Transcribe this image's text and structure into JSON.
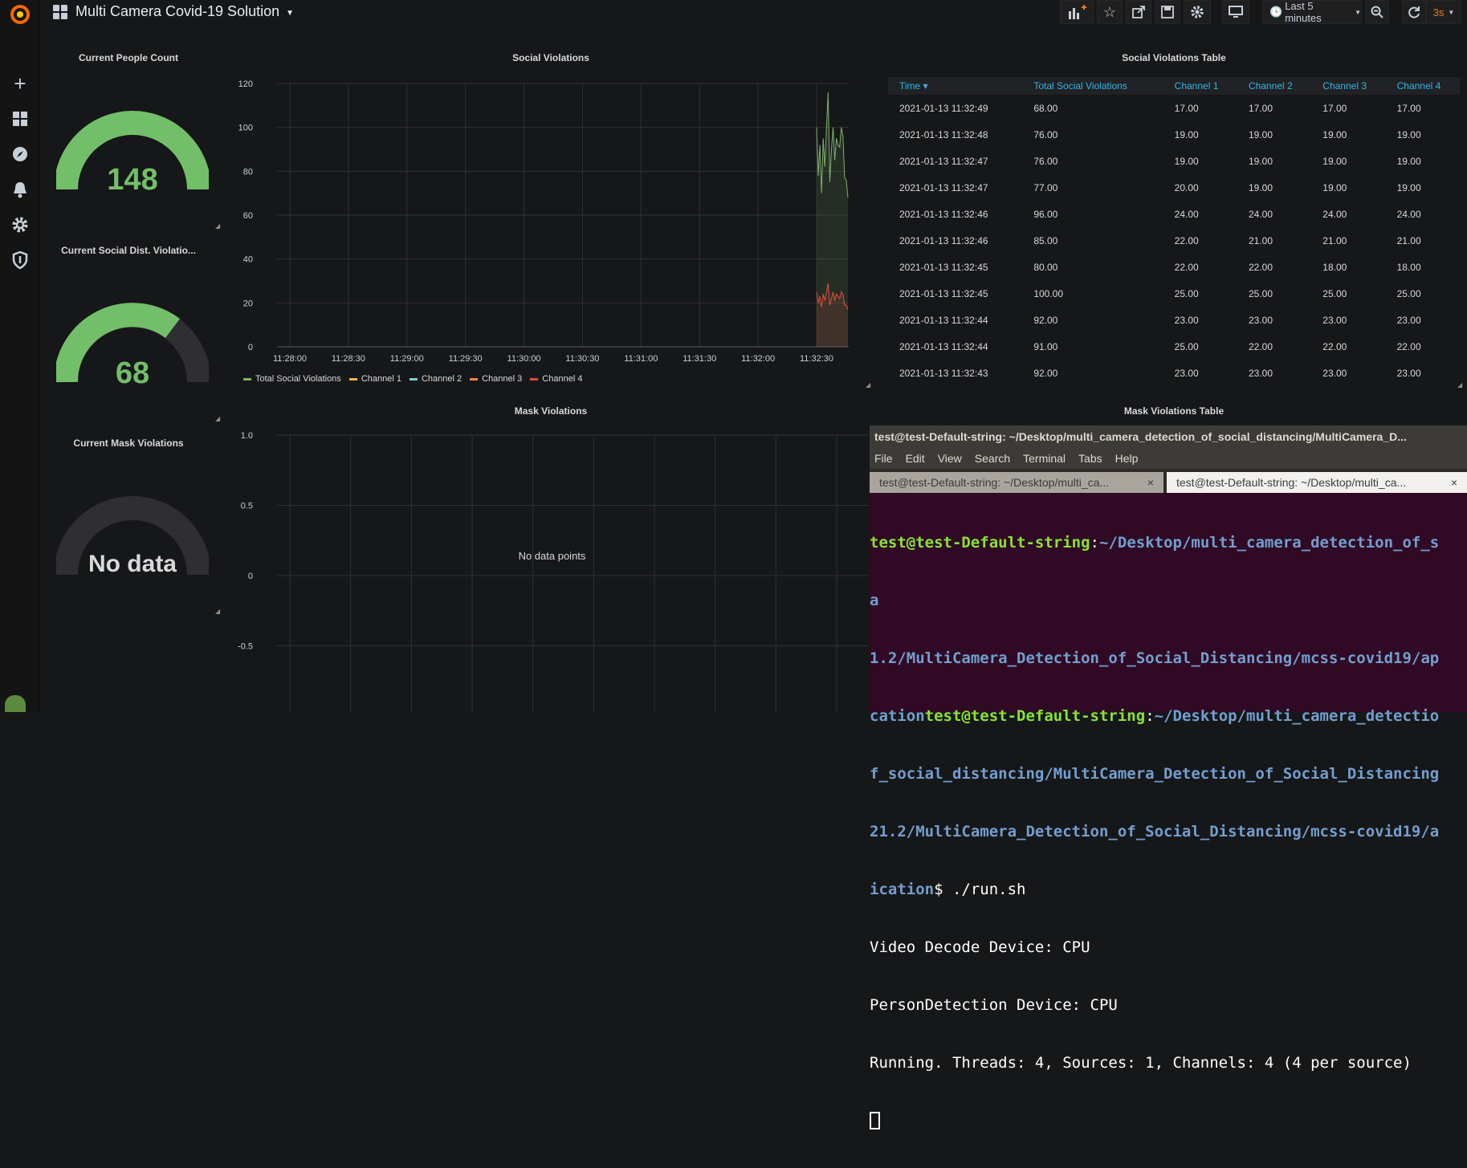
{
  "dashboard": {
    "title": "Multi Camera Covid-19 Solution",
    "time_range": "Last 5 minutes",
    "refresh": "3s"
  },
  "sidebar": {
    "icons": [
      "grafana-logo-icon",
      "plus-icon",
      "dashboards-icon",
      "explore-icon",
      "alerting-icon",
      "configuration-icon",
      "shield-icon",
      "user-avatar-icon"
    ]
  },
  "gauges": [
    {
      "title": "Current People Count",
      "value": "148",
      "fraction": 1.0,
      "color": "#73bf69"
    },
    {
      "title": "Current Social Dist. Violatio...",
      "value": "68",
      "fraction": 0.68,
      "color": "#73bf69"
    },
    {
      "title": "Current Mask Violations",
      "value": "No data",
      "fraction": 0,
      "color": "#d8d9da"
    }
  ],
  "social_chart": {
    "title": "Social Violations",
    "y_ticks": [
      "120",
      "100",
      "80",
      "60",
      "40",
      "20",
      "0"
    ],
    "x_ticks": [
      "11:28:00",
      "11:28:30",
      "11:29:00",
      "11:29:30",
      "11:30:00",
      "11:30:30",
      "11:31:00",
      "11:31:30",
      "11:32:00",
      "11:32:30"
    ],
    "legend": [
      {
        "name": "Total Social Violations",
        "color": "#7eb26d"
      },
      {
        "name": "Channel 1",
        "color": "#eab839"
      },
      {
        "name": "Channel 2",
        "color": "#6ed0e0"
      },
      {
        "name": "Channel 3",
        "color": "#ef843c"
      },
      {
        "name": "Channel 4",
        "color": "#e24d42"
      }
    ]
  },
  "chart_data": {
    "type": "line",
    "title": "Social Violations",
    "xlabel": "",
    "ylabel": "",
    "ylim": [
      0,
      120
    ],
    "x": [
      "11:32:30",
      "11:32:31",
      "11:32:32",
      "11:32:33",
      "11:32:34",
      "11:32:35",
      "11:32:36",
      "11:32:37",
      "11:32:38",
      "11:32:39",
      "11:32:40",
      "11:32:41",
      "11:32:42",
      "11:32:43",
      "11:32:44",
      "11:32:45",
      "11:32:46",
      "11:32:47",
      "11:32:48",
      "11:32:49"
    ],
    "series": [
      {
        "name": "Total Social Violations",
        "values": [
          100,
          78,
          92,
          70,
          95,
          82,
          100,
          116,
          75,
          90,
          100,
          85,
          95,
          92,
          91,
          100,
          96,
          77,
          76,
          68
        ]
      },
      {
        "name": "Channel 4",
        "values": [
          25,
          20,
          23,
          18,
          24,
          21,
          25,
          29,
          19,
          22,
          25,
          21,
          24,
          23,
          22,
          25,
          24,
          19,
          19,
          17
        ]
      }
    ],
    "grid": true,
    "legend": "bottom"
  },
  "social_table": {
    "title": "Social Violations Table",
    "columns": [
      "Time",
      "Total Social Violations",
      "Channel 1",
      "Channel 2",
      "Channel 3",
      "Channel 4"
    ],
    "rows": [
      [
        "2021-01-13 11:32:49",
        "68.00",
        "17.00",
        "17.00",
        "17.00",
        "17.00"
      ],
      [
        "2021-01-13 11:32:48",
        "76.00",
        "19.00",
        "19.00",
        "19.00",
        "19.00"
      ],
      [
        "2021-01-13 11:32:47",
        "76.00",
        "19.00",
        "19.00",
        "19.00",
        "19.00"
      ],
      [
        "2021-01-13 11:32:47",
        "77.00",
        "20.00",
        "19.00",
        "19.00",
        "19.00"
      ],
      [
        "2021-01-13 11:32:46",
        "96.00",
        "24.00",
        "24.00",
        "24.00",
        "24.00"
      ],
      [
        "2021-01-13 11:32:46",
        "85.00",
        "22.00",
        "21.00",
        "21.00",
        "21.00"
      ],
      [
        "2021-01-13 11:32:45",
        "80.00",
        "22.00",
        "22.00",
        "18.00",
        "18.00"
      ],
      [
        "2021-01-13 11:32:45",
        "100.00",
        "25.00",
        "25.00",
        "25.00",
        "25.00"
      ],
      [
        "2021-01-13 11:32:44",
        "92.00",
        "23.00",
        "23.00",
        "23.00",
        "23.00"
      ],
      [
        "2021-01-13 11:32:44",
        "91.00",
        "25.00",
        "22.00",
        "22.00",
        "22.00"
      ],
      [
        "2021-01-13 11:32:43",
        "92.00",
        "23.00",
        "23.00",
        "23.00",
        "23.00"
      ]
    ]
  },
  "mask_chart": {
    "title": "Mask Violations",
    "y_ticks": [
      "1.0",
      "0.5",
      "0",
      "-0.5"
    ],
    "empty_text": "No data points"
  },
  "mask_table": {
    "title": "Mask Violations Table"
  },
  "terminal": {
    "title": "test@test-Default-string: ~/Desktop/multi_camera_detection_of_social_distancing/MultiCamera_D...",
    "menu": [
      "File",
      "Edit",
      "View",
      "Search",
      "Terminal",
      "Tabs",
      "Help"
    ],
    "tabs": [
      "test@test-Default-string: ~/Desktop/multi_ca...",
      "test@test-Default-string: ~/Desktop/multi_ca..."
    ],
    "prompt_user": "test@test-Default-string",
    "line1_path": "~/Desktop/multi_camera_detection_of_s",
    "line2": "a",
    "line3_path": "1.2/MultiCamera_Detection_of_Social_Distancing/mcss-covid19/ap",
    "line4_prefix": "cation",
    "line4_path": "~/Desktop/multi_camera_detectio",
    "line5_path": "f_social_distancing/MultiCamera_Detection_of_Social_Distancing",
    "line6_path": "21.2/MultiCamera_Detection_of_Social_Distancing/mcss-covid19/a",
    "line7_path": "ication",
    "command": "$ ./run.sh",
    "output": [
      "Video Decode Device: CPU",
      "PersonDetection Device: CPU",
      "Running. Threads: 4, Sources: 1, Channels: 4 (4 per source)"
    ]
  }
}
